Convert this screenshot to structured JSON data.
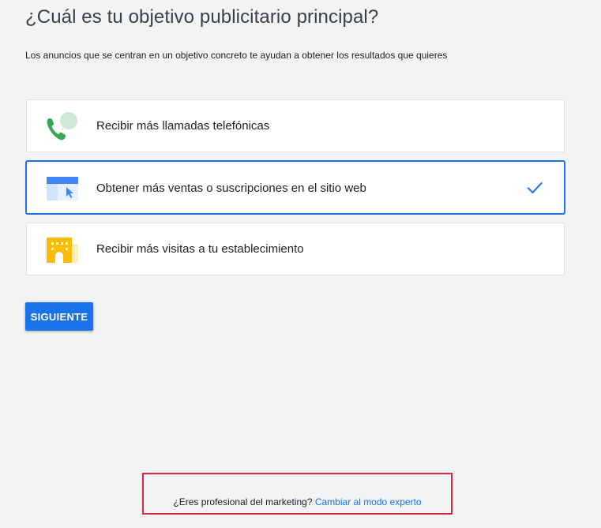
{
  "header": {
    "title": "¿Cuál es tu objetivo publicitario principal?",
    "subtitle": "Los anuncios que se centran en un objetivo concreto te ayudan a obtener los resultados que quieres"
  },
  "options": [
    {
      "label": "Recibir más llamadas telefónicas",
      "icon": "phone-call-icon",
      "selected": false
    },
    {
      "label": "Obtener más ventas o suscripciones en el sitio web",
      "icon": "website-cursor-icon",
      "selected": true
    },
    {
      "label": "Recibir más visitas a tu establecimiento",
      "icon": "storefront-icon",
      "selected": false
    }
  ],
  "actions": {
    "next_label": "SIGUIENTE"
  },
  "expert": {
    "question": "¿Eres profesional del marketing?",
    "link_label": "Cambiar al modo experto"
  },
  "colors": {
    "accent": "#1a73e8",
    "background": "#f1f3f4",
    "highlight_border": "#d6283c",
    "phone_green": "#34a853",
    "store_yellow": "#fbbc04"
  }
}
